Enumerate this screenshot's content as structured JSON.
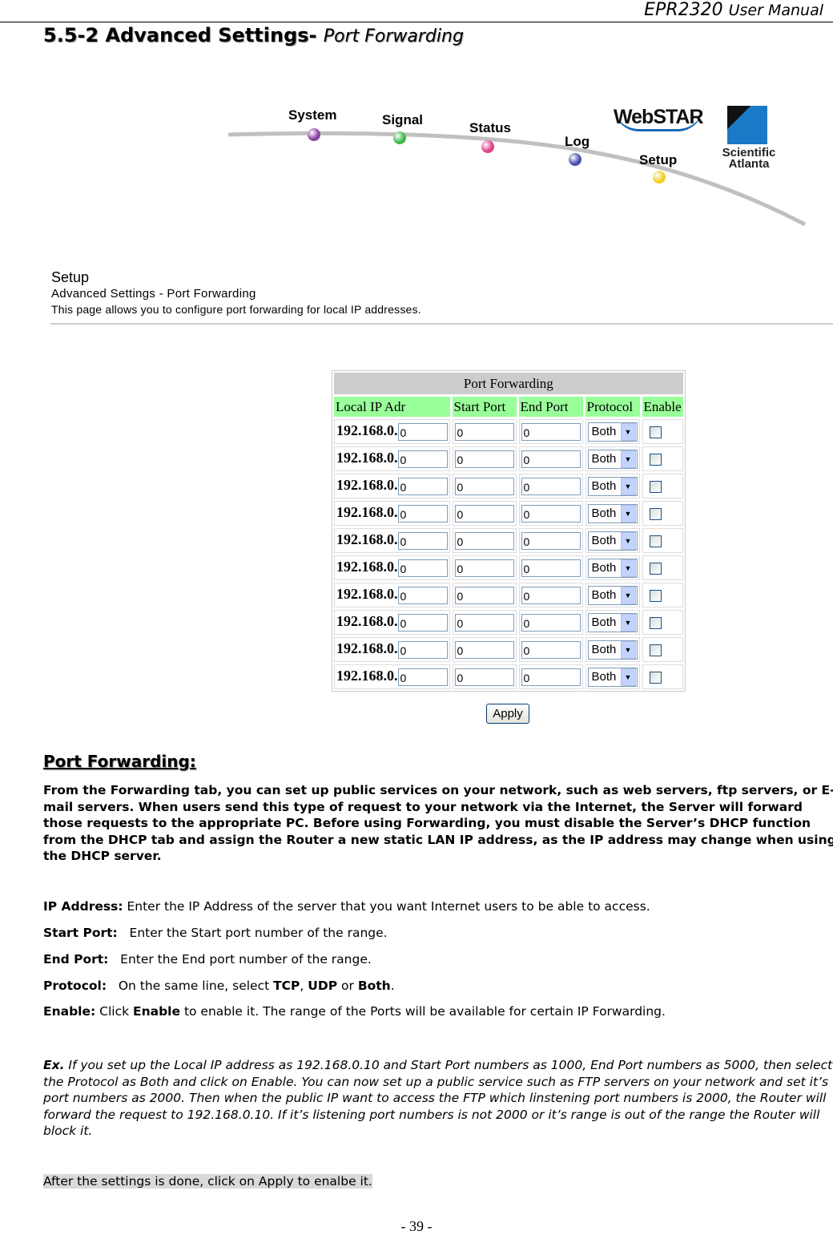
{
  "header": {
    "product": "EPR2320",
    "suffix": "User Manual"
  },
  "title": {
    "number_label": "5.5-2 Advanced Settings-",
    "subtitle": "Port Forwarding"
  },
  "nav": {
    "items": [
      {
        "label": "System",
        "color": "#8a3fa0"
      },
      {
        "label": "Signal",
        "color": "#3cb84a"
      },
      {
        "label": "Status",
        "color": "#e0408a"
      },
      {
        "label": "Log",
        "color": "#4a50b0"
      },
      {
        "label": "Setup",
        "color": "#f0d020"
      }
    ],
    "logo_webstar": "WebSTAR",
    "logo_sa": "Scientific Atlanta"
  },
  "setup": {
    "heading": "Setup",
    "subheading": "Advanced Settings - Port Forwarding",
    "description": "This page allows you to configure port forwarding for local IP addresses."
  },
  "table": {
    "caption": "Port Forwarding",
    "columns": [
      "Local IP Adr",
      "Start Port",
      "End Port",
      "Protocol",
      "Enable"
    ],
    "ip_prefix": "192.168.0.",
    "rows": [
      {
        "ip": "0",
        "start": "0",
        "end": "0",
        "protocol": "Both",
        "enabled": false
      },
      {
        "ip": "0",
        "start": "0",
        "end": "0",
        "protocol": "Both",
        "enabled": false
      },
      {
        "ip": "0",
        "start": "0",
        "end": "0",
        "protocol": "Both",
        "enabled": false
      },
      {
        "ip": "0",
        "start": "0",
        "end": "0",
        "protocol": "Both",
        "enabled": false
      },
      {
        "ip": "0",
        "start": "0",
        "end": "0",
        "protocol": "Both",
        "enabled": false
      },
      {
        "ip": "0",
        "start": "0",
        "end": "0",
        "protocol": "Both",
        "enabled": false
      },
      {
        "ip": "0",
        "start": "0",
        "end": "0",
        "protocol": "Both",
        "enabled": false
      },
      {
        "ip": "0",
        "start": "0",
        "end": "0",
        "protocol": "Both",
        "enabled": false
      },
      {
        "ip": "0",
        "start": "0",
        "end": "0",
        "protocol": "Both",
        "enabled": false
      },
      {
        "ip": "0",
        "start": "0",
        "end": "0",
        "protocol": "Both",
        "enabled": false
      }
    ],
    "apply_label": "Apply"
  },
  "section": {
    "heading": "Port Forwarding:",
    "intro": "From the Forwarding tab, you can set up public services on your network, such as web servers, ftp servers, or E-mail servers. When users send this type of request to your network via the Internet, the Server will forward those requests to the appropriate PC. Before using Forwarding, you must disable the Server’s DHCP function from the DHCP tab and assign the Router a new static LAN IP address, as the IP address may change when using the DHCP server.",
    "defs": {
      "ip_label": "IP Address:",
      "ip_text": " Enter the IP Address of the server that you want Internet users to be able to access.",
      "start_label": "Start Port:",
      "start_text": "   Enter the Start port number of the range.",
      "end_label": "End Port:",
      "end_text": "   Enter the End port number of the range.",
      "protocol_label": "Protocol:",
      "protocol_text1": "   On the same line, select ",
      "tcp": "TCP",
      "comma": ", ",
      "udp": "UDP",
      "or": " or ",
      "both": "Both",
      "period": ".",
      "enable_label": "Enable:",
      "enable_text1": " Click ",
      "enable_word": "Enable",
      "enable_text2": " to enable it. The range of the Ports will be available for certain IP Forwarding."
    },
    "example_label": "Ex.",
    "example_text": " If you set up the Local IP address as 192.168.0.10 and Start Port numbers as 1000, End Port numbers as 5000, then select the Protocol as Both and click on Enable. You can now set up a public service such as FTP servers on your network and set it’s port numbers as 2000. Then when the public IP want to access the FTP which linstening port numbers is 2000, the Router will forward the request to 192.168.0.10. If it’s listening port numbers is not 2000 or it’s range is out of the range the Router will block it.",
    "after": "After the settings is done, click on Apply to enalbe it."
  },
  "footer": {
    "page": "- 39 -"
  }
}
